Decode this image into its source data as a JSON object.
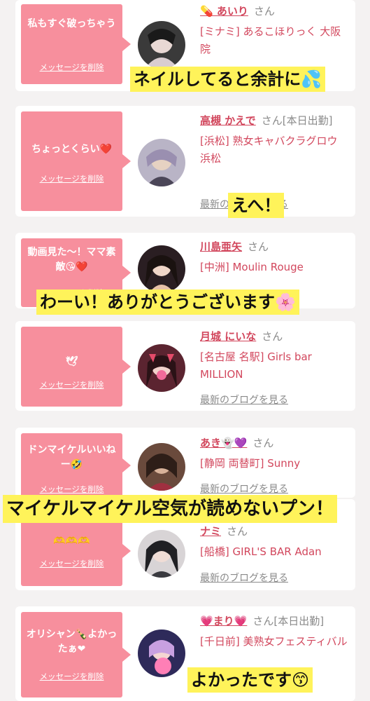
{
  "delete_label": "メッセージを削除",
  "blog_label": "最新のブログを見る",
  "san": "さん",
  "cards": [
    {
      "message": "私もすぐ破っちゃう",
      "name": "💊 あいり",
      "tag": "",
      "shop": "[ミナミ] あるこほりっく 大阪院",
      "caption": "ネイルしてると余計に💦"
    },
    {
      "message": "ちょっとくらい❤️",
      "name": "高槻 かえで",
      "tag": "[本日出勤]",
      "shop": "[浜松] 熟女キャバクラグロウ 浜松",
      "caption": "えへ！"
    },
    {
      "message": "動画見た〜！ママ素敵😘❤️",
      "name": "川島亜矢",
      "tag": "",
      "shop": "[中洲] Moulin Rouge",
      "caption": "わーい！ありがとうございます🌸"
    },
    {
      "message": "🕊",
      "name": "月城 にいな",
      "tag": "",
      "shop": "[名古屋 名駅] Girls bar MILLION",
      "caption": ""
    },
    {
      "message": "ドンマイケルいいねー🤣",
      "name": "あき👻💜",
      "tag": "",
      "shop": "[静岡 両替町] Sunny",
      "caption": "マイケルマイケル空気が読めないプン！"
    },
    {
      "message": "🫶🫶🫶",
      "name": "ナミ",
      "tag": "",
      "shop": "[船橋] GIRL'S BAR Adan",
      "caption": ""
    },
    {
      "message": "オリシャン🍾よかったぁ❤",
      "name": "💗まり💗",
      "tag": "[本日出勤]",
      "shop": "[千日前] 美熟女フェスティバル",
      "caption": "よかったです😙"
    }
  ]
}
